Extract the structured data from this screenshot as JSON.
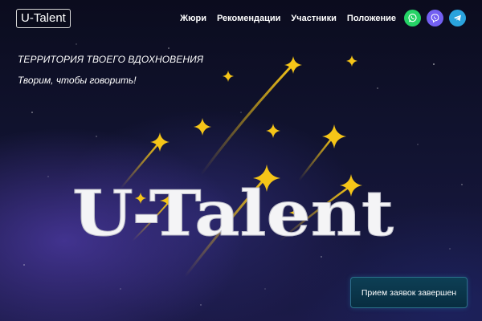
{
  "header": {
    "logo": "U-Talent",
    "nav": [
      {
        "label": "Жюри"
      },
      {
        "label": "Рекомендации"
      },
      {
        "label": "Участники"
      },
      {
        "label": "Положение"
      }
    ],
    "socials": [
      {
        "icon": "whatsapp-icon",
        "color": "#25d366"
      },
      {
        "icon": "viber-icon",
        "color": "#7360f2"
      },
      {
        "icon": "telegram-icon",
        "color": "#2aa3dd"
      }
    ]
  },
  "hero": {
    "tagline": "ТЕРРИТОРИЯ ТВОЕГО ВДОХНОВЕНИЯ",
    "subtitle": "Творим, чтобы говорить!",
    "title": "U-Talent",
    "star_color": "#f5c518",
    "cta_label": "Прием заявок завершен"
  }
}
